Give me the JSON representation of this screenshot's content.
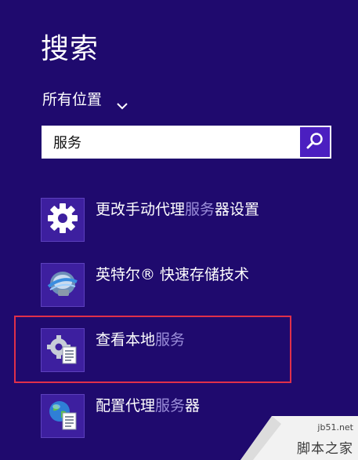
{
  "header": {
    "title": "搜索"
  },
  "scope": {
    "label": "所有位置"
  },
  "search": {
    "value": "服务"
  },
  "results": [
    {
      "before": "更改手动代理",
      "match": "服务",
      "after": "器设置",
      "icon": "gear-icon"
    },
    {
      "before": "英特尔® 快速存储技术",
      "match": "",
      "after": "",
      "icon": "intel-storage-icon"
    },
    {
      "before": "查看本地",
      "match": "服务",
      "after": "",
      "icon": "services-icon"
    },
    {
      "before": "配置代理",
      "match": "服务",
      "after": "器",
      "icon": "globe-document-icon"
    }
  ],
  "watermark": {
    "url": "jb51.net",
    "name": "脚本之家"
  },
  "colors": {
    "background": "#1f0a6e",
    "accent": "#4b1fc0",
    "highlight": "#e0304a",
    "match_text": "#9b8ed9"
  }
}
